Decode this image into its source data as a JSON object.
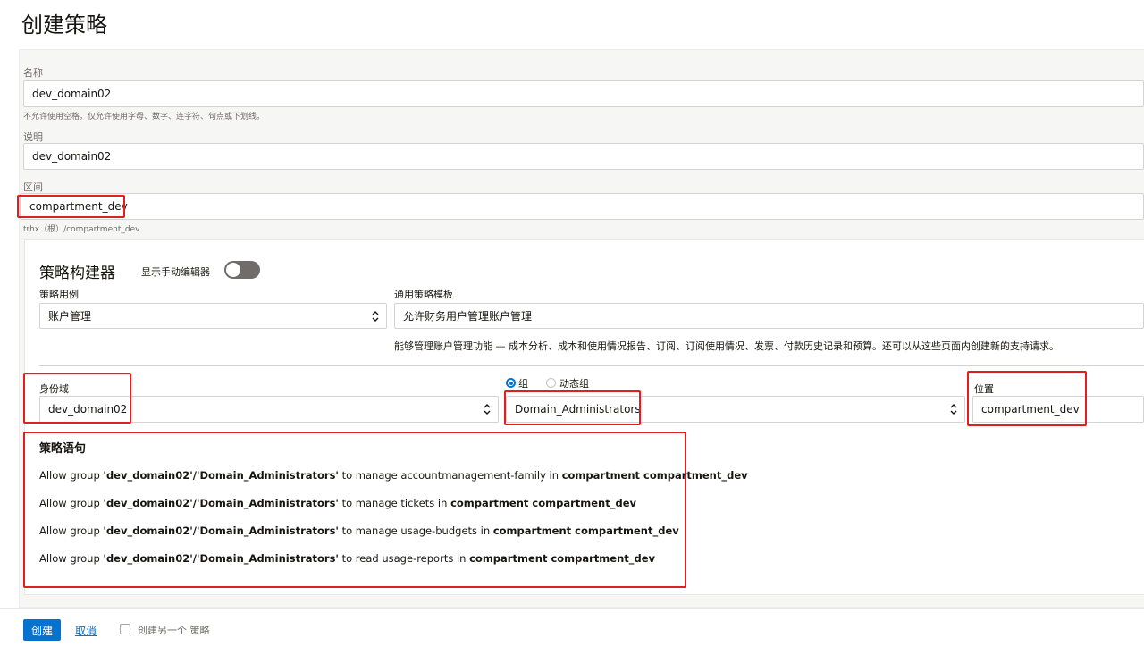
{
  "page": {
    "title": "创建策略"
  },
  "form": {
    "name": {
      "label": "名称",
      "value": "dev_domain02",
      "hint": "不允许使用空格。仅允许使用字母、数字、连字符、句点或下划线。"
    },
    "description": {
      "label": "说明",
      "value": "dev_domain02"
    },
    "compartment": {
      "label": "区间",
      "value": "compartment_dev",
      "path": "trhx（根）/compartment_dev"
    }
  },
  "builder": {
    "title": "策略构建器",
    "manual_editor_label": "显示手动编辑器",
    "use_case": {
      "label": "策略用例",
      "value": "账户管理"
    },
    "template": {
      "label": "通用策略模板",
      "value": "允许财务用户管理账户管理",
      "description": "能够管理账户管理功能 — 成本分析、成本和使用情况报告、订阅、订阅使用情况、发票、付款历史记录和预算。还可以从这些页面内创建新的支持请求。"
    },
    "identity_domain": {
      "label": "身份域",
      "value": "dev_domain02"
    },
    "group_type": {
      "option_group": "组",
      "option_dynamic": "动态组"
    },
    "group": {
      "value": "Domain_Administrators"
    },
    "location": {
      "label": "位置",
      "value": "compartment_dev"
    }
  },
  "statements": {
    "title": "策略语句",
    "items": [
      {
        "prefix": "Allow group ",
        "subject": "'dev_domain02'/'Domain_Administrators'",
        "verb": " to manage accountmanagement-family in ",
        "target": "compartment compartment_dev"
      },
      {
        "prefix": "Allow group ",
        "subject": "'dev_domain02'/'Domain_Administrators'",
        "verb": " to manage tickets in ",
        "target": "compartment compartment_dev"
      },
      {
        "prefix": "Allow group ",
        "subject": "'dev_domain02'/'Domain_Administrators'",
        "verb": " to manage usage-budgets in ",
        "target": "compartment compartment_dev"
      },
      {
        "prefix": "Allow group ",
        "subject": "'dev_domain02'/'Domain_Administrators'",
        "verb": " to read usage-reports in ",
        "target": "compartment compartment_dev"
      }
    ]
  },
  "footer": {
    "create_label": "创建",
    "cancel_label": "取消",
    "create_another_label": "创建另一个 策略"
  },
  "colors": {
    "accent": "#0572ce",
    "highlight": "#e02020"
  }
}
